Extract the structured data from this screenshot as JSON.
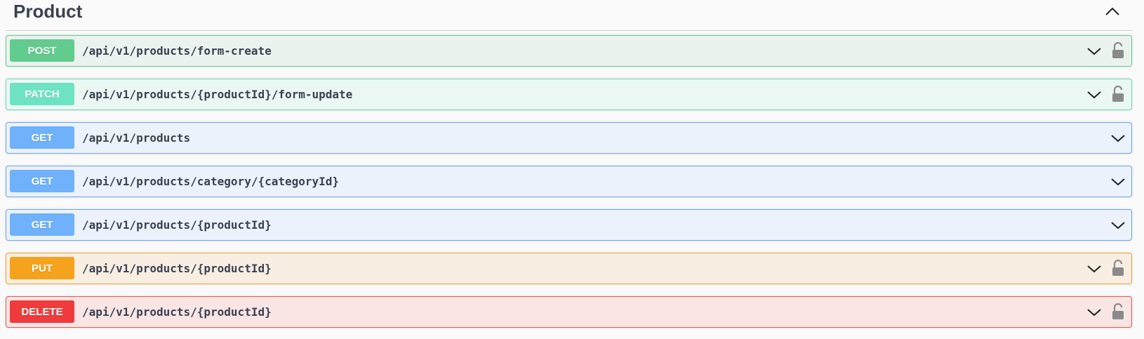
{
  "section": {
    "title": "Product",
    "collapse_icon": "chevron-up-icon"
  },
  "colors": {
    "post": "#62cc8e",
    "patch": "#6ee3c4",
    "get": "#6fb1fb",
    "put": "#f5a21d",
    "delete": "#ef3b3b",
    "text": "#3b4151"
  },
  "operations": [
    {
      "method": "POST",
      "path": "/api/v1/products/form-create",
      "locked": true
    },
    {
      "method": "PATCH",
      "path": "/api/v1/products/{productId}/form-update",
      "locked": true
    },
    {
      "method": "GET",
      "path": "/api/v1/products",
      "locked": false
    },
    {
      "method": "GET",
      "path": "/api/v1/products/category/{categoryId}",
      "locked": false
    },
    {
      "method": "GET",
      "path": "/api/v1/products/{productId}",
      "locked": false
    },
    {
      "method": "PUT",
      "path": "/api/v1/products/{productId}",
      "locked": true
    },
    {
      "method": "DELETE",
      "path": "/api/v1/products/{productId}",
      "locked": true
    }
  ]
}
